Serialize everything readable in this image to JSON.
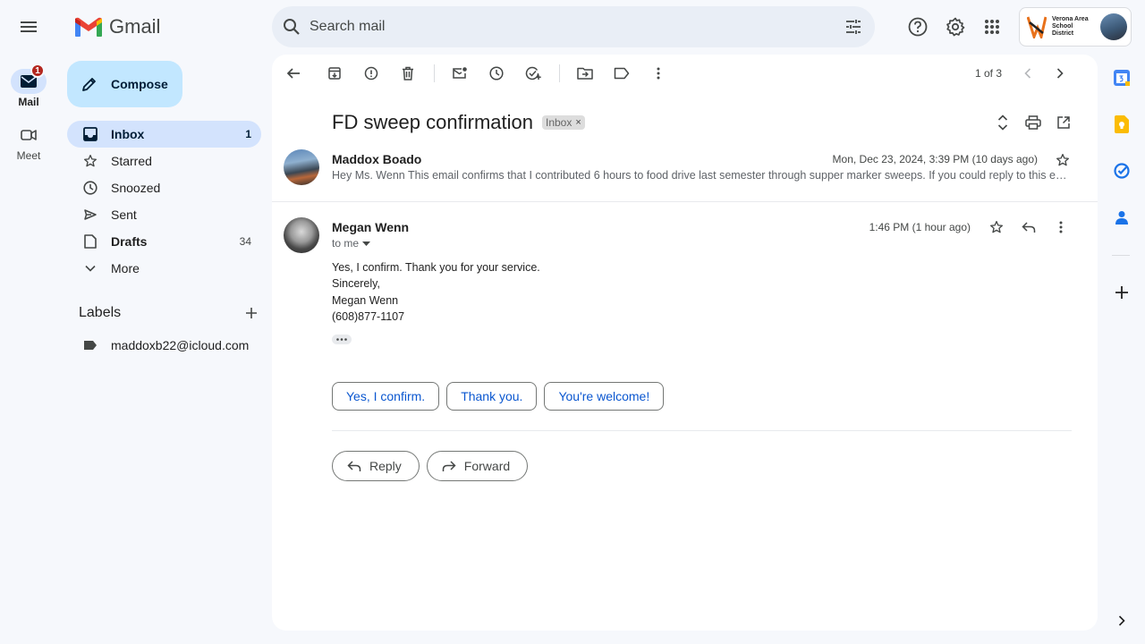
{
  "rail": {
    "mail_label": "Mail",
    "mail_badge": "1",
    "meet_label": "Meet"
  },
  "brand": {
    "name": "Gmail"
  },
  "compose": {
    "label": "Compose"
  },
  "nav": {
    "items": [
      {
        "label": "Inbox",
        "count": "1"
      },
      {
        "label": "Starred",
        "count": ""
      },
      {
        "label": "Snoozed",
        "count": ""
      },
      {
        "label": "Sent",
        "count": ""
      },
      {
        "label": "Drafts",
        "count": "34"
      },
      {
        "label": "More",
        "count": ""
      }
    ]
  },
  "labels": {
    "title": "Labels",
    "items": [
      {
        "label": "maddoxb22@icloud.com"
      }
    ]
  },
  "search": {
    "placeholder": "Search mail"
  },
  "account": {
    "org_line1": "Verona Area",
    "org_line2": "School District"
  },
  "pager": {
    "text": "1 of 3"
  },
  "thread": {
    "subject": "FD sweep confirmation",
    "chip": "Inbox",
    "chip_close": "×",
    "messages": [
      {
        "sender": "Maddox Boado",
        "date": "Mon, Dec 23, 2024, 3:39 PM (10 days ago)",
        "snippet": "Hey Ms. Wenn This email confirms that I contributed 6 hours to food drive last semester through supper marker sweeps. If you could reply to this email that would be great."
      },
      {
        "sender": "Megan Wenn",
        "to": "to me",
        "time": "1:46 PM (1 hour ago)",
        "body": [
          "Yes, I confirm. Thank you for your service.",
          "Sincerely,",
          "Megan Wenn",
          "(608)877-1107"
        ]
      }
    ],
    "smart_replies": [
      "Yes, I confirm.",
      "Thank you.",
      "You're welcome!"
    ],
    "reply_label": "Reply",
    "forward_label": "Forward"
  },
  "colors": {
    "accent": "#0b57d0",
    "active_nav": "#d3e3fd",
    "compose": "#c2e7ff",
    "badge": "#b3261e",
    "background": "#f6f8fc"
  }
}
